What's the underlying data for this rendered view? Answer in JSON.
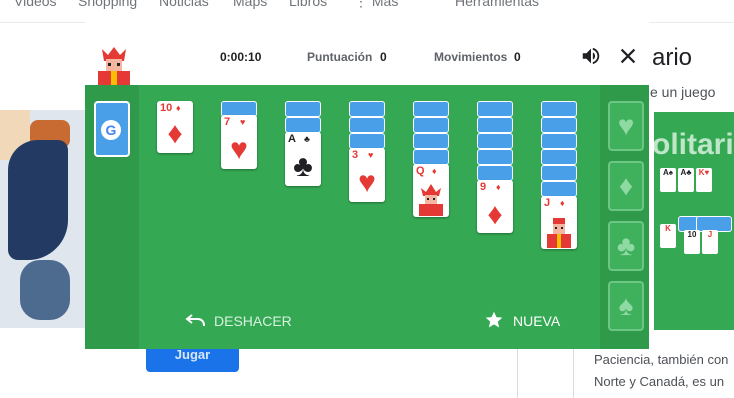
{
  "background": {
    "nav_items": [
      "Videos",
      "Shopping",
      "Noticias",
      "Maps",
      "Libros",
      "Más",
      "Herramientas"
    ],
    "title_partial": "ario",
    "subtitle_partial": "e un juego",
    "play_button": "Jugar",
    "desc_line1": "Paciencia, también con",
    "desc_line2": "Norte y Canadá, es un",
    "right_image_text": "olitario"
  },
  "game": {
    "timer": "0:00:10",
    "score_label": "Puntuación",
    "score": "0",
    "moves_label": "Movimientos",
    "moves": "0",
    "undo_label": "DESHACER",
    "new_label": "NUEVA",
    "stock_logo": "G",
    "foundations": [
      "heart",
      "diamond",
      "club",
      "spade"
    ],
    "tableau": [
      {
        "hidden": 0,
        "top_rank": "10",
        "top_suit": "♦",
        "color": "red"
      },
      {
        "hidden": 1,
        "top_rank": "7",
        "top_suit": "♥",
        "color": "red"
      },
      {
        "hidden": 2,
        "top_rank": "A",
        "top_suit": "♣",
        "color": "black"
      },
      {
        "hidden": 3,
        "top_rank": "3",
        "top_suit": "♥",
        "color": "red"
      },
      {
        "hidden": 4,
        "top_rank": "Q",
        "top_suit": "♦",
        "color": "red"
      },
      {
        "hidden": 5,
        "top_rank": "9",
        "top_suit": "♦",
        "color": "red"
      },
      {
        "hidden": 6,
        "top_rank": "J",
        "top_suit": "♦",
        "color": "red"
      }
    ],
    "colors": {
      "felt": "#34a853",
      "side": "#2e9a4a",
      "card_back": "#4aa0e8"
    }
  }
}
